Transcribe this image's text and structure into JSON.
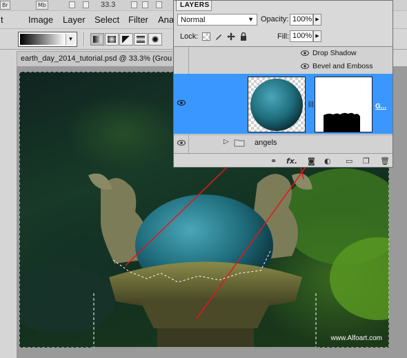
{
  "app": {
    "top_badges": [
      "Br",
      "Mb"
    ],
    "zoom_value": "33.3"
  },
  "menu": {
    "items": [
      "t",
      "Image",
      "Layer",
      "Select",
      "Filter",
      "Anal"
    ]
  },
  "document": {
    "tab_title": "earth_day_2014_tutorial.psd @ 33.3% (Grou"
  },
  "canvas": {
    "watermark": "www.Alfoart.com"
  },
  "layers_panel": {
    "tab_label": "LAYERS",
    "blend_mode": "Normal",
    "opacity_label": "Opacity:",
    "opacity_value": "100%",
    "lock_label": "Lock:",
    "fill_label": "Fill:",
    "fill_value": "100%",
    "effects": [
      "Drop Shadow",
      "Bevel and Emboss"
    ],
    "selected_layer_name": "G...",
    "group_name": "angels"
  },
  "colors": {
    "selection_blue": "#3a97ff",
    "annotation_red": "#e8141a"
  }
}
